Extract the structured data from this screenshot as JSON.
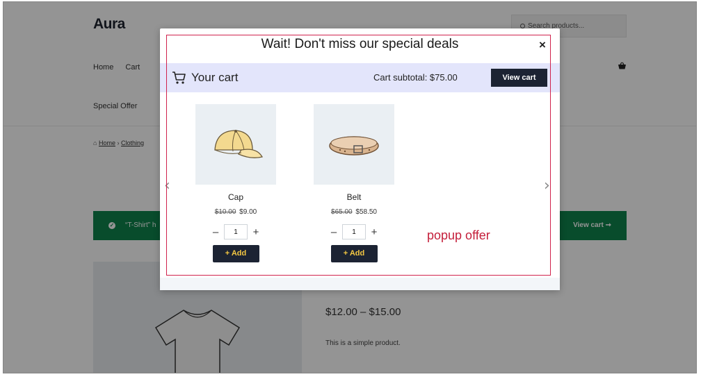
{
  "store": {
    "brand": "Aura",
    "search_placeholder": "Search products...",
    "nav": [
      "Home",
      "Cart"
    ],
    "nav_secondary": "Special Offer",
    "breadcrumb": {
      "home": "Home",
      "sep": "›",
      "clothing": "Clothing"
    },
    "notice": {
      "message": "“T-Shirt” h",
      "view_cart": "View cart ➞"
    },
    "price_range": "$12.00 – $15.00",
    "description": "This is a simple product."
  },
  "popup": {
    "title": "Wait! Don't miss our special deals",
    "close": "×",
    "cart_title": "Your cart",
    "subtotal": "Cart subtotal: $75.00",
    "view_cart": "View cart",
    "arrow_left": "‹",
    "arrow_right": "›",
    "products": [
      {
        "name": "Cap",
        "old_price": "$10.00",
        "price": "$9.00",
        "qty": "1",
        "add": "+ Add",
        "minus": "–",
        "plus": "+"
      },
      {
        "name": "Belt",
        "old_price": "$65.00",
        "price": "$58.50",
        "qty": "1",
        "add": "+ Add",
        "minus": "–",
        "plus": "+"
      }
    ]
  },
  "annotation": {
    "label": "popup offer"
  },
  "colors": {
    "accent_dark": "#1c2333",
    "cart_bar": "#e3e5fb",
    "notice_green": "#0f834d",
    "annotation_red": "#c41e3a",
    "add_text": "#f5c842"
  }
}
